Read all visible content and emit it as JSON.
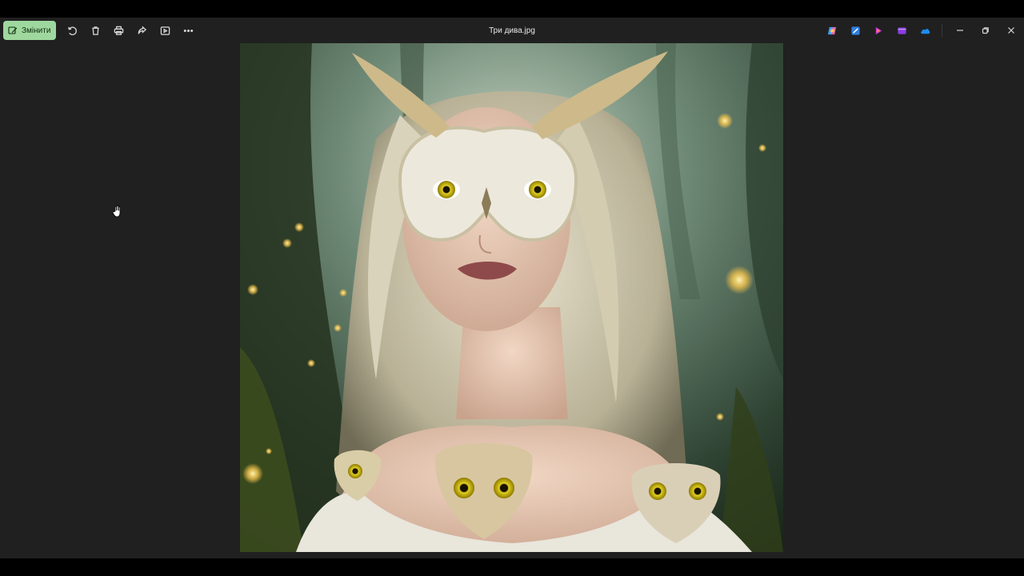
{
  "app": {
    "file_title": "Три дива.jpg"
  },
  "toolbar": {
    "edit_label": "Змінити",
    "buttons": [
      {
        "icon": "rotate-icon"
      },
      {
        "icon": "delete-icon"
      },
      {
        "icon": "print-icon"
      },
      {
        "icon": "share-icon"
      },
      {
        "icon": "slideshow-icon"
      },
      {
        "icon": "more-icon"
      }
    ],
    "accent_color": "#9fd89f"
  },
  "apps": [
    {
      "icon": "copilot-icon"
    },
    {
      "icon": "designer-icon"
    },
    {
      "icon": "clipchamp-icon"
    },
    {
      "icon": "clipchamp-video-icon"
    },
    {
      "icon": "onedrive-icon"
    }
  ],
  "window_controls": [
    "minimize-icon",
    "restore-icon",
    "close-icon"
  ],
  "image": {
    "subject": "owl-mask-woman-photo"
  }
}
